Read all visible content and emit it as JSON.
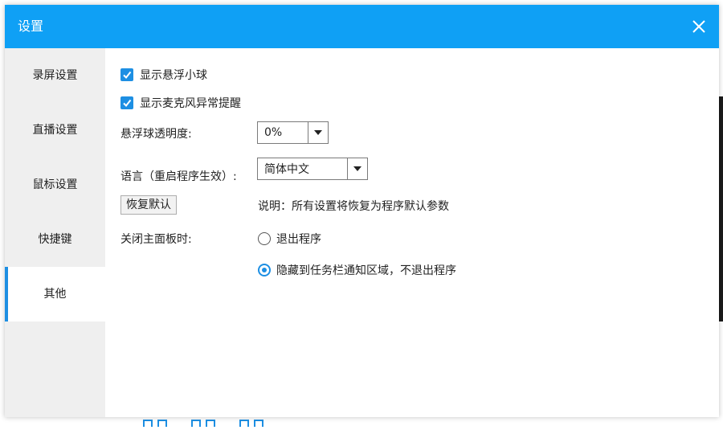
{
  "window": {
    "title": "设置",
    "close_icon": "close-icon"
  },
  "colors": {
    "title_bar": "#0fa0f5",
    "accent": "#1d8fe3",
    "sidebar_bg": "#efefef"
  },
  "sidebar": {
    "items": [
      {
        "label": "录屏设置",
        "active": false
      },
      {
        "label": "直播设置",
        "active": false
      },
      {
        "label": "鼠标设置",
        "active": false
      },
      {
        "label": "快捷键",
        "active": false
      },
      {
        "label": "其他",
        "active": true
      }
    ]
  },
  "settings": {
    "show_float_ball": {
      "label": "显示悬浮小球",
      "checked": true
    },
    "show_mic_alert": {
      "label": "显示麦克风异常提醒",
      "checked": true
    },
    "opacity": {
      "label": "悬浮球透明度:",
      "value": "0%"
    },
    "language": {
      "label": "语言（重启程序生效）:",
      "value": "简体中文"
    },
    "restore": {
      "button_label": "恢复默认",
      "note": "说明：所有设置将恢复为程序默认参数"
    },
    "close_panel": {
      "label": "关闭主面板时:",
      "options": [
        {
          "label": "退出程序",
          "selected": false
        },
        {
          "label": "隐藏到任务栏通知区域，不退出程序",
          "selected": true
        }
      ]
    }
  }
}
